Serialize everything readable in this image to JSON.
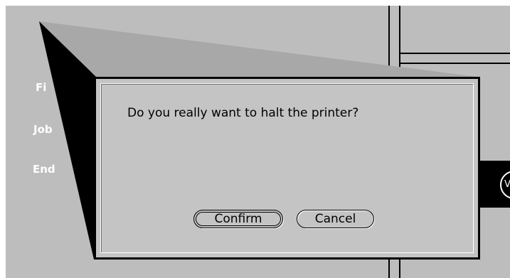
{
  "dialog": {
    "message": "Do you really want to halt the printer?",
    "buttons": {
      "confirm_label": "Confirm",
      "cancel_label": "Cancel"
    }
  },
  "background": {
    "labels": [
      "Fi",
      "Job",
      "End"
    ],
    "right_glyph": "V"
  },
  "colors": {
    "window_gray": "#bdbdbd",
    "dialog_gray": "#c4c4c4",
    "zoom_shadow": "#000000",
    "zoom_light": "#a8a8a8",
    "label_text": "#ffffff"
  }
}
